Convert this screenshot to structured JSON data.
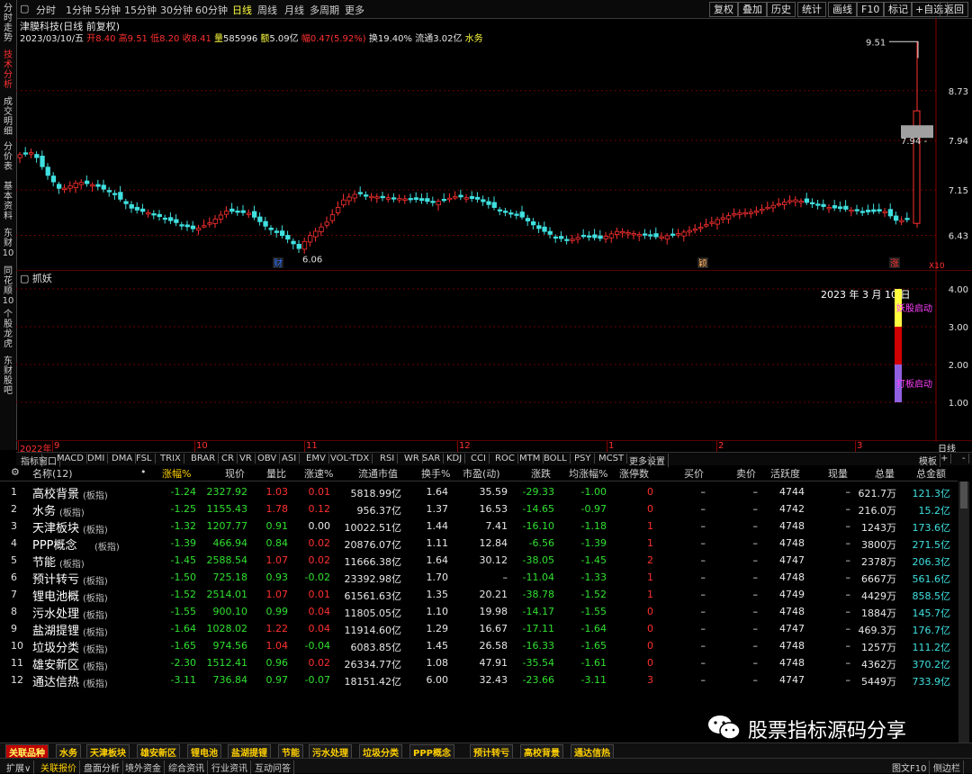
{
  "toolbar": {
    "tabs": [
      "分时",
      "1分钟",
      "5分钟",
      "15分钟",
      "30分钟",
      "60分钟",
      "日线",
      "周线",
      "月线",
      "多周期",
      "更多"
    ],
    "active_tab": "日线",
    "right_buttons": [
      "复权",
      "叠加",
      "历史",
      "统计",
      "画线",
      "F10",
      "标记",
      "+自选",
      "返回"
    ]
  },
  "left_tabs": [
    "分时走势",
    "技术分析",
    "成交明细",
    "分价表",
    "基本资料",
    "东财10",
    "同花顺10",
    "个股龙虎",
    "东财股吧"
  ],
  "left_active": "技术分析",
  "stock": {
    "name_line": "津膜科技(日线 前复权)",
    "date": "2023/03/10/五",
    "open_label": "开",
    "open": "8.40",
    "high_label": "高",
    "high": "9.51",
    "low_label": "低",
    "low": "8.20",
    "close_label": "收",
    "close": "8.41",
    "vol_label": "量",
    "vol": "585996",
    "amt_label": "额",
    "amt": "5.09亿",
    "chg_label": "幅",
    "chg": "0.47(5.92%)",
    "turn_label": "换",
    "turn": "19.40%",
    "float_label": "流通",
    "float": "3.02亿",
    "sector": "水务"
  },
  "price_axis": [
    "8.73",
    "7.94",
    "7.15",
    "6.43"
  ],
  "annotations": {
    "high_mark": "9.51",
    "low_mark": "6.06",
    "current_box": "7.94",
    "cai": "财",
    "ying": "颖",
    "zhang": "涨",
    "x10": "X10"
  },
  "sub": {
    "title": "抓妖",
    "date_label": "2023 年 3 月 10 日",
    "axis": [
      "4.00",
      "3.00",
      "2.00",
      "1.00"
    ],
    "label_top": "妖股启动",
    "label_bottom": "打板启动"
  },
  "date_axis": [
    "2022年",
    "9",
    "10",
    "11",
    "12",
    "1",
    "2",
    "3"
  ],
  "date_axis_right": "日线",
  "indicators": [
    "指标",
    "窗口",
    "MACD",
    "DMI",
    "DMA",
    "FSL",
    "TRIX",
    "BRAR",
    "CR",
    "VR",
    "OBV",
    "ASI",
    "EMV",
    "VOL-TDX",
    "RSI",
    "WR",
    "SAR",
    "KDJ",
    "CCI",
    "ROC",
    "MTM",
    "BOLL",
    "PSY",
    "MCST",
    "更多",
    "设置"
  ],
  "ind_right": [
    "模板",
    "+",
    "-"
  ],
  "table": {
    "headers": [
      "名称(12)",
      "•",
      "涨幅%",
      "现价",
      "量比",
      "涨速%",
      "流通市值",
      "换手%",
      "市盈(动)",
      "涨跌",
      "均涨幅%",
      "涨停数",
      "买价",
      "卖价",
      "活跃度",
      "现量",
      "总量",
      "总金额"
    ],
    "rows": [
      {
        "n": "1",
        "name": "高校背景",
        "tag": "(板指)",
        "chg": "-1.24",
        "price": "2327.92",
        "lb": "1.03",
        "spd": "0.01",
        "mv": "5818.99亿",
        "turn": "1.64",
        "pe": "35.59",
        "diff": "-29.33",
        "avg": "-1.00",
        "zt": "0",
        "buy": "–",
        "sell": "–",
        "act": "4744",
        "cur": "–",
        "tv": "621.7万",
        "amt": "121.3亿"
      },
      {
        "n": "2",
        "name": "水务",
        "tag": "(板指)",
        "chg": "-1.25",
        "price": "1155.43",
        "lb": "1.78",
        "spd": "0.12",
        "mv": "956.37亿",
        "turn": "1.37",
        "pe": "16.53",
        "diff": "-14.65",
        "avg": "-0.97",
        "zt": "0",
        "buy": "–",
        "sell": "–",
        "act": "4742",
        "cur": "–",
        "tv": "216.0万",
        "amt": "15.2亿"
      },
      {
        "n": "3",
        "name": "天津板块",
        "tag": "(板指)",
        "chg": "-1.32",
        "price": "1207.77",
        "lb": "0.91",
        "spd": "0.00",
        "mv": "10022.51亿",
        "turn": "1.44",
        "pe": "7.41",
        "diff": "-16.10",
        "avg": "-1.18",
        "zt": "1",
        "buy": "–",
        "sell": "–",
        "act": "4748",
        "cur": "–",
        "tv": "1243万",
        "amt": "173.6亿"
      },
      {
        "n": "4",
        "name": "PPP概念",
        "tag": "(板指)",
        "chg": "-1.39",
        "price": "466.94",
        "lb": "0.84",
        "spd": "0.02",
        "mv": "20876.07亿",
        "turn": "1.11",
        "pe": "12.84",
        "diff": "-6.56",
        "avg": "-1.39",
        "zt": "1",
        "buy": "–",
        "sell": "–",
        "act": "4748",
        "cur": "–",
        "tv": "3800万",
        "amt": "271.5亿"
      },
      {
        "n": "5",
        "name": "节能",
        "tag": "(板指)",
        "chg": "-1.45",
        "price": "2588.54",
        "lb": "1.07",
        "spd": "0.02",
        "mv": "11666.38亿",
        "turn": "1.64",
        "pe": "30.12",
        "diff": "-38.05",
        "avg": "-1.45",
        "zt": "2",
        "buy": "–",
        "sell": "–",
        "act": "4747",
        "cur": "–",
        "tv": "2378万",
        "amt": "206.3亿"
      },
      {
        "n": "6",
        "name": "预计转亏",
        "tag": "(板指)",
        "chg": "-1.50",
        "price": "725.18",
        "lb": "0.93",
        "spd": "-0.02",
        "mv": "23392.98亿",
        "turn": "1.70",
        "pe": "–",
        "diff": "-11.04",
        "avg": "-1.33",
        "zt": "1",
        "buy": "–",
        "sell": "–",
        "act": "4748",
        "cur": "–",
        "tv": "6667万",
        "amt": "561.6亿"
      },
      {
        "n": "7",
        "name": "锂电池概",
        "tag": "(板指)",
        "chg": "-1.52",
        "price": "2514.01",
        "lb": "1.07",
        "spd": "0.01",
        "mv": "61561.63亿",
        "turn": "1.35",
        "pe": "20.21",
        "diff": "-38.78",
        "avg": "-1.52",
        "zt": "1",
        "buy": "–",
        "sell": "–",
        "act": "4749",
        "cur": "–",
        "tv": "4429万",
        "amt": "858.5亿"
      },
      {
        "n": "8",
        "name": "污水处理",
        "tag": "(板指)",
        "chg": "-1.55",
        "price": "900.10",
        "lb": "0.99",
        "spd": "0.04",
        "mv": "11805.05亿",
        "turn": "1.10",
        "pe": "19.98",
        "diff": "-14.17",
        "avg": "-1.55",
        "zt": "0",
        "buy": "–",
        "sell": "–",
        "act": "4748",
        "cur": "–",
        "tv": "1884万",
        "amt": "145.7亿"
      },
      {
        "n": "9",
        "name": "盐湖提锂",
        "tag": "(板指)",
        "chg": "-1.64",
        "price": "1028.02",
        "lb": "1.22",
        "spd": "0.04",
        "mv": "11914.60亿",
        "turn": "1.29",
        "pe": "16.67",
        "diff": "-17.11",
        "avg": "-1.64",
        "zt": "0",
        "buy": "–",
        "sell": "–",
        "act": "4747",
        "cur": "–",
        "tv": "469.3万",
        "amt": "176.7亿"
      },
      {
        "n": "10",
        "name": "垃圾分类",
        "tag": "(板指)",
        "chg": "-1.65",
        "price": "974.56",
        "lb": "1.04",
        "spd": "-0.04",
        "mv": "6083.85亿",
        "turn": "1.45",
        "pe": "26.58",
        "diff": "-16.33",
        "avg": "-1.65",
        "zt": "0",
        "buy": "–",
        "sell": "–",
        "act": "4748",
        "cur": "–",
        "tv": "1257万",
        "amt": "111.2亿"
      },
      {
        "n": "11",
        "name": "雄安新区",
        "tag": "(板指)",
        "chg": "-2.30",
        "price": "1512.41",
        "lb": "0.96",
        "spd": "0.02",
        "mv": "26334.77亿",
        "turn": "1.08",
        "pe": "47.91",
        "diff": "-35.54",
        "avg": "-1.61",
        "zt": "0",
        "buy": "–",
        "sell": "–",
        "act": "4748",
        "cur": "–",
        "tv": "4362万",
        "amt": "370.2亿"
      },
      {
        "n": "12",
        "name": "通达信热",
        "tag": "(板指)",
        "chg": "-3.11",
        "price": "736.84",
        "lb": "0.97",
        "spd": "-0.07",
        "mv": "18151.42亿",
        "turn": "6.00",
        "pe": "32.43",
        "diff": "-23.66",
        "avg": "-3.11",
        "zt": "3",
        "buy": "–",
        "sell": "–",
        "act": "4747",
        "cur": "–",
        "tv": "5449万",
        "amt": "733.9亿"
      }
    ]
  },
  "block_tabs": [
    "关联品种",
    "水务",
    "天津板块",
    "雄安新区",
    "锂电池",
    "盐湖提锂",
    "节能",
    "污水处理",
    "垃圾分类",
    "PPP概念",
    "预计转亏",
    "高校背景",
    "通达信热"
  ],
  "status_items": [
    "扩展∨",
    "关联报价",
    "盘面分析",
    "境外资金",
    "综合资讯",
    "行业资讯",
    "互动问答"
  ],
  "status_right": [
    "图文F10",
    "侧边栏"
  ],
  "watermark": "股票指标源码分享",
  "colors": {
    "up": "#ff3030",
    "down": "#40e0e0",
    "neutral": "#e8e8e8",
    "accent": "#ffff40",
    "table_green": "#30e030"
  }
}
